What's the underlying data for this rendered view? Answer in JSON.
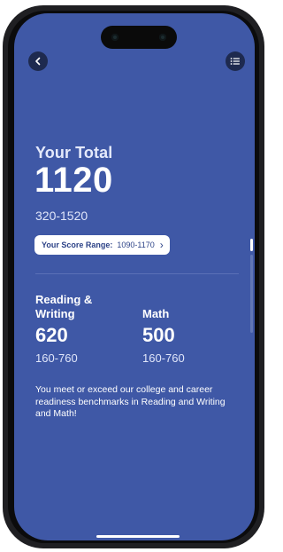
{
  "theme": {
    "screen_bg": "#3f58a6",
    "pill_text": "#2c4287",
    "button_bg": "#1e2a4f"
  },
  "header": {
    "back_icon": "chevron-left-icon",
    "menu_icon": "list-icon"
  },
  "total": {
    "heading": "Your Total",
    "score": "1120",
    "range": "320-1520",
    "range_pill": {
      "label": "Your Score Range:",
      "value": "1090-1170",
      "chevron": "›"
    }
  },
  "sections": [
    {
      "title_line1": "Reading &",
      "title_line2": "Writing",
      "score": "620",
      "range": "160-760"
    },
    {
      "title_line1": "",
      "title_line2": "Math",
      "score": "500",
      "range": "160-760"
    }
  ],
  "message": "You meet or exceed our college and career readiness benchmarks in Reading and Writing and Math!"
}
